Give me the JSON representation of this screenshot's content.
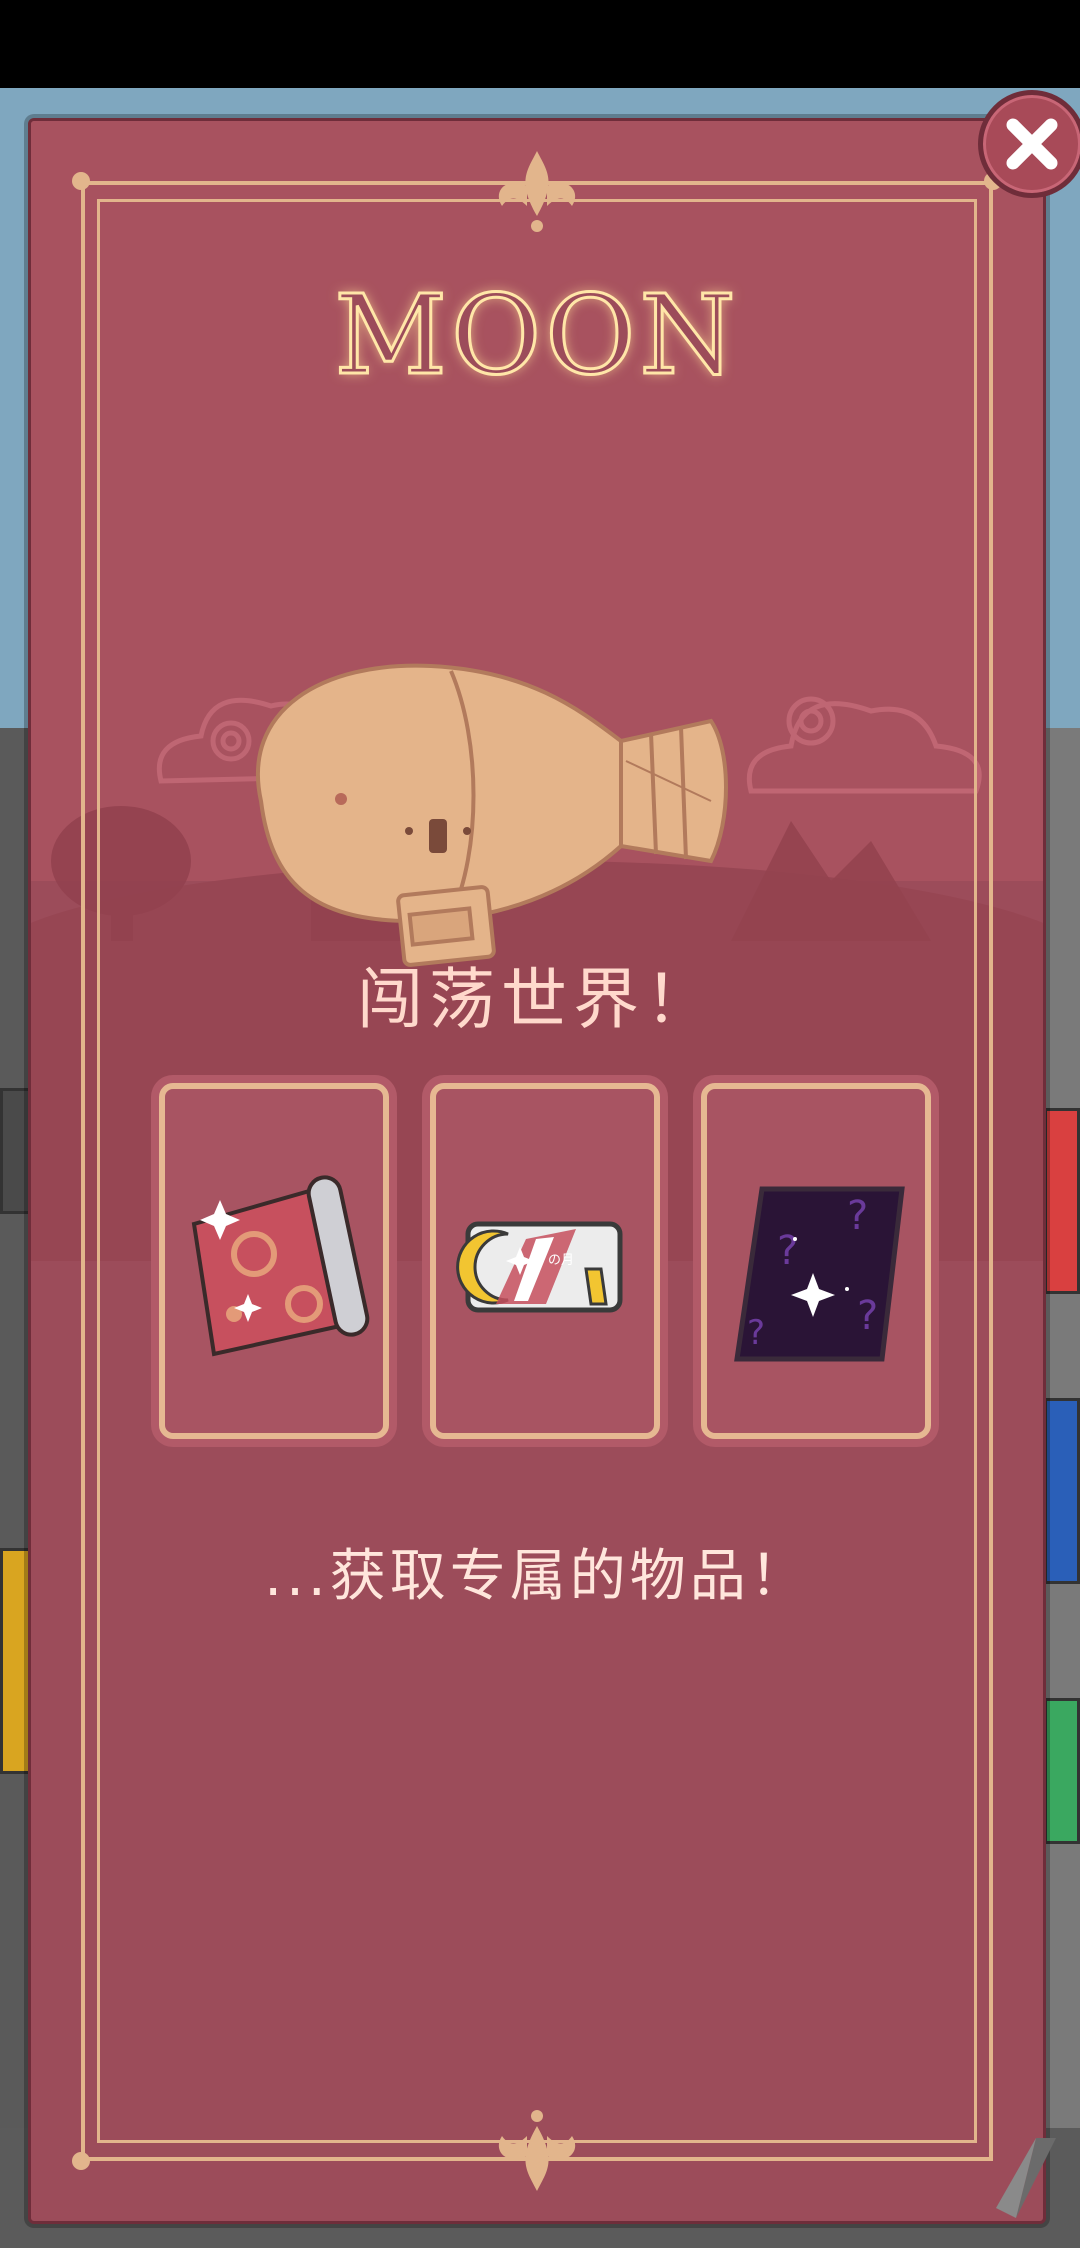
{
  "dialog": {
    "title": "MOON",
    "headline": "闯荡世界！",
    "subline": "...获取专属的物品！",
    "card_items": [
      {
        "icon": "wallpaper-roll-icon"
      },
      {
        "icon": "moon-ticket-card-icon",
        "text": "の月"
      },
      {
        "icon": "mystery-galaxy-book-icon"
      }
    ]
  },
  "colors": {
    "panel": "#9c4c5a",
    "frame": "#e2b58c",
    "title_glow": "#ffe6a8",
    "headline": "#ffd9cc"
  }
}
